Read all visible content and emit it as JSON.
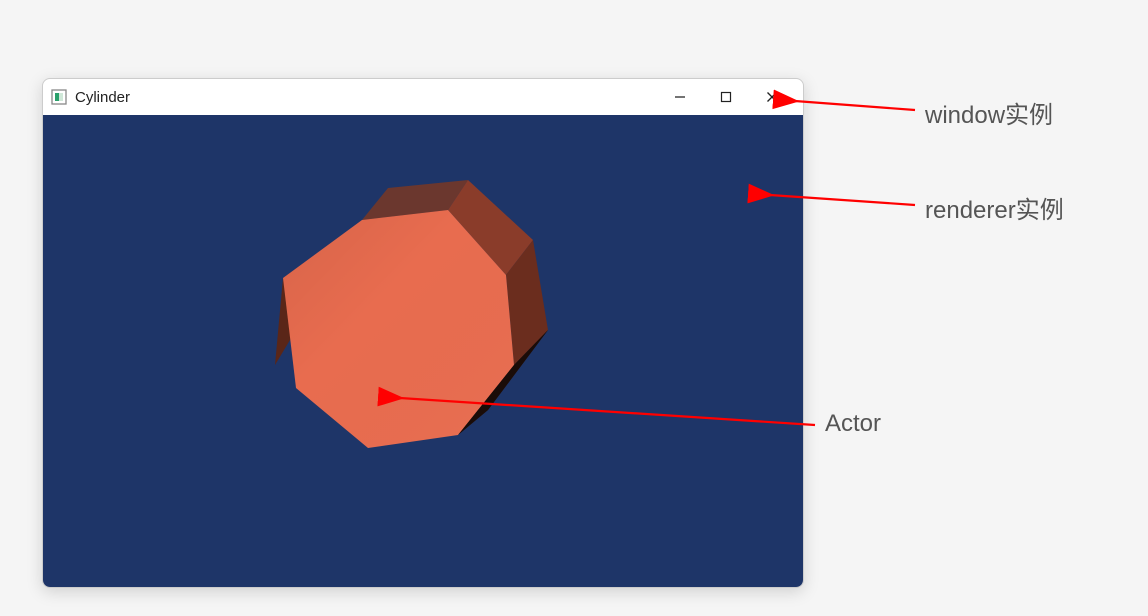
{
  "window": {
    "title": "Cylinder"
  },
  "annotations": {
    "window_instance": "window实例",
    "renderer_instance": "renderer实例",
    "actor": "Actor"
  },
  "colors": {
    "viewport_bg": "#1e3568",
    "actor_face": "#e86c4f",
    "actor_side_dark": "#6b2d1e",
    "arrow": "#ff0000"
  }
}
